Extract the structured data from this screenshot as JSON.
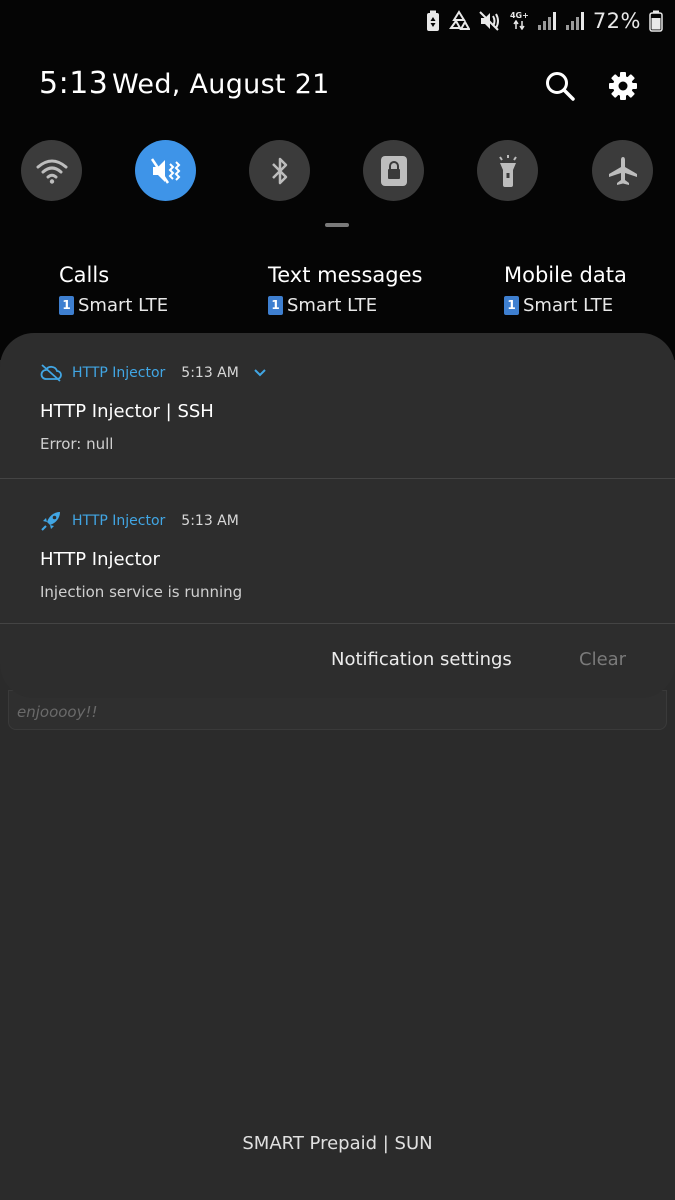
{
  "status_bar": {
    "battery": "72%",
    "network_label": "4G+",
    "icons": [
      "battery-saver-icon",
      "recycle-icon",
      "vibrate-mute-icon",
      "signal-icon",
      "signal-icon",
      "battery-icon"
    ]
  },
  "header": {
    "time": "5:13",
    "date": "Wed, August 21",
    "icons": [
      "search-icon",
      "gear-icon"
    ]
  },
  "quick_settings": [
    {
      "name": "wifi",
      "icon": "wifi-icon",
      "active": false
    },
    {
      "name": "sound",
      "icon": "vibrate-mute-icon",
      "active": true
    },
    {
      "name": "bluetooth",
      "icon": "bluetooth-icon",
      "active": false
    },
    {
      "name": "rotation-lock",
      "icon": "lock-icon",
      "active": false
    },
    {
      "name": "flashlight",
      "icon": "flashlight-icon",
      "active": false
    },
    {
      "name": "airplane-mode",
      "icon": "airplane-icon",
      "active": false
    }
  ],
  "sim": {
    "calls": {
      "label": "Calls",
      "sim_number": "1",
      "value": "Smart LTE"
    },
    "text_messages": {
      "label": "Text messages",
      "sim_number": "1",
      "value": "Smart LTE"
    },
    "mobile_data": {
      "label": "Mobile data",
      "sim_number": "1",
      "value": "Smart LTE"
    }
  },
  "notifications": [
    {
      "app": "HTTP Injector",
      "time": "5:13 AM",
      "title": "HTTP Injector | SSH",
      "text": "Error: null",
      "icon": "cloud-off-icon",
      "expandable": true
    },
    {
      "app": "HTTP Injector",
      "time": "5:13 AM",
      "title": "HTTP Injector",
      "text": "Injection service is running",
      "icon": "rocket-icon",
      "expandable": false
    }
  ],
  "actions": {
    "notification_settings": "Notification settings",
    "clear": "Clear"
  },
  "background": {
    "card_text": "enjooooy!!",
    "carrier": "SMART Prepaid | SUN"
  },
  "colors": {
    "accent": "#3e94e8",
    "app_name": "#41a6e4",
    "shade": "#050505",
    "panel": "#2d2d2d"
  }
}
